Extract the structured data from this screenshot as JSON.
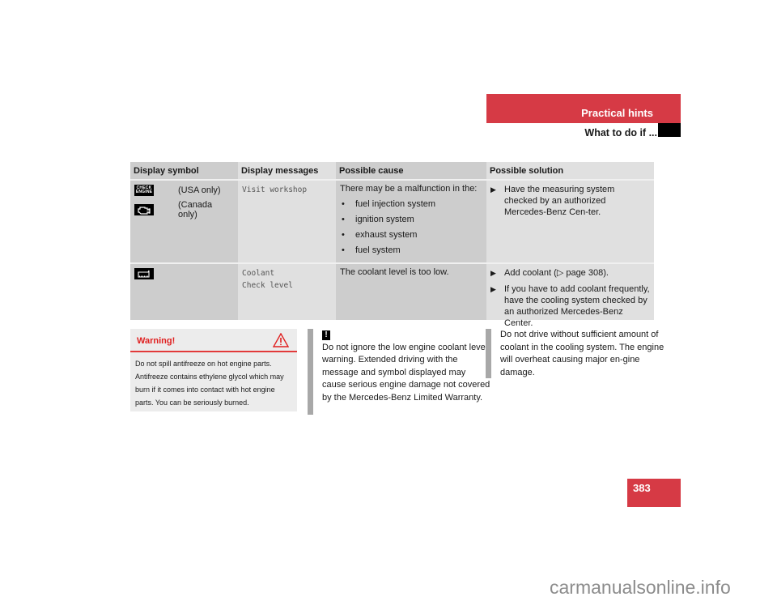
{
  "header": {
    "section": "Practical hints",
    "subsection": "What to do if ..."
  },
  "table": {
    "headers": [
      "Display symbol",
      "Display messages",
      "Possible cause",
      "Possible solution"
    ],
    "rows": [
      {
        "symbols": [
          {
            "icon": "check-engine-icon",
            "icon_text": "CHECK ENGINE",
            "label": "(USA only)"
          },
          {
            "icon": "engine-outline-icon",
            "label": "(Canada only)"
          }
        ],
        "messages": [
          "Visit workshop"
        ],
        "cause_intro": "There may be a malfunction in the:",
        "cause_bullets": [
          "fuel injection system",
          "ignition system",
          "exhaust system",
          "fuel system"
        ],
        "solutions": [
          "Have the measuring system checked by an authorized Mercedes-Benz Cen-ter."
        ]
      },
      {
        "symbols": [
          {
            "icon": "coolant-icon",
            "label": ""
          }
        ],
        "messages": [
          "Coolant",
          "Check level"
        ],
        "cause_intro": "The coolant level is too low.",
        "cause_bullets": [],
        "solutions": [
          "Add coolant (▷ page 308).",
          "If you have to add coolant frequently, have the cooling system checked by an authorized Mercedes-Benz Center."
        ]
      }
    ]
  },
  "warning": {
    "title": "Warning!",
    "text": "Do not spill antifreeze on hot engine parts. Antifreeze contains ethylene glycol which may burn if it comes into contact with hot engine parts. You can be seriously burned.",
    "color": "#e02020"
  },
  "notes": [
    {
      "icon": "!",
      "text": "Do not ignore the low engine coolant level warning. Extended driving with the message and symbol displayed may cause serious engine damage not covered by the Mercedes-Benz Limited Warranty."
    },
    {
      "text": "Do not drive without sufficient amount of coolant in the cooling system. The engine will overheat causing major en-gine damage."
    }
  ],
  "page_number": "383",
  "watermark": "carmanualsonline.info",
  "colors": {
    "accent": "#d63a45"
  }
}
